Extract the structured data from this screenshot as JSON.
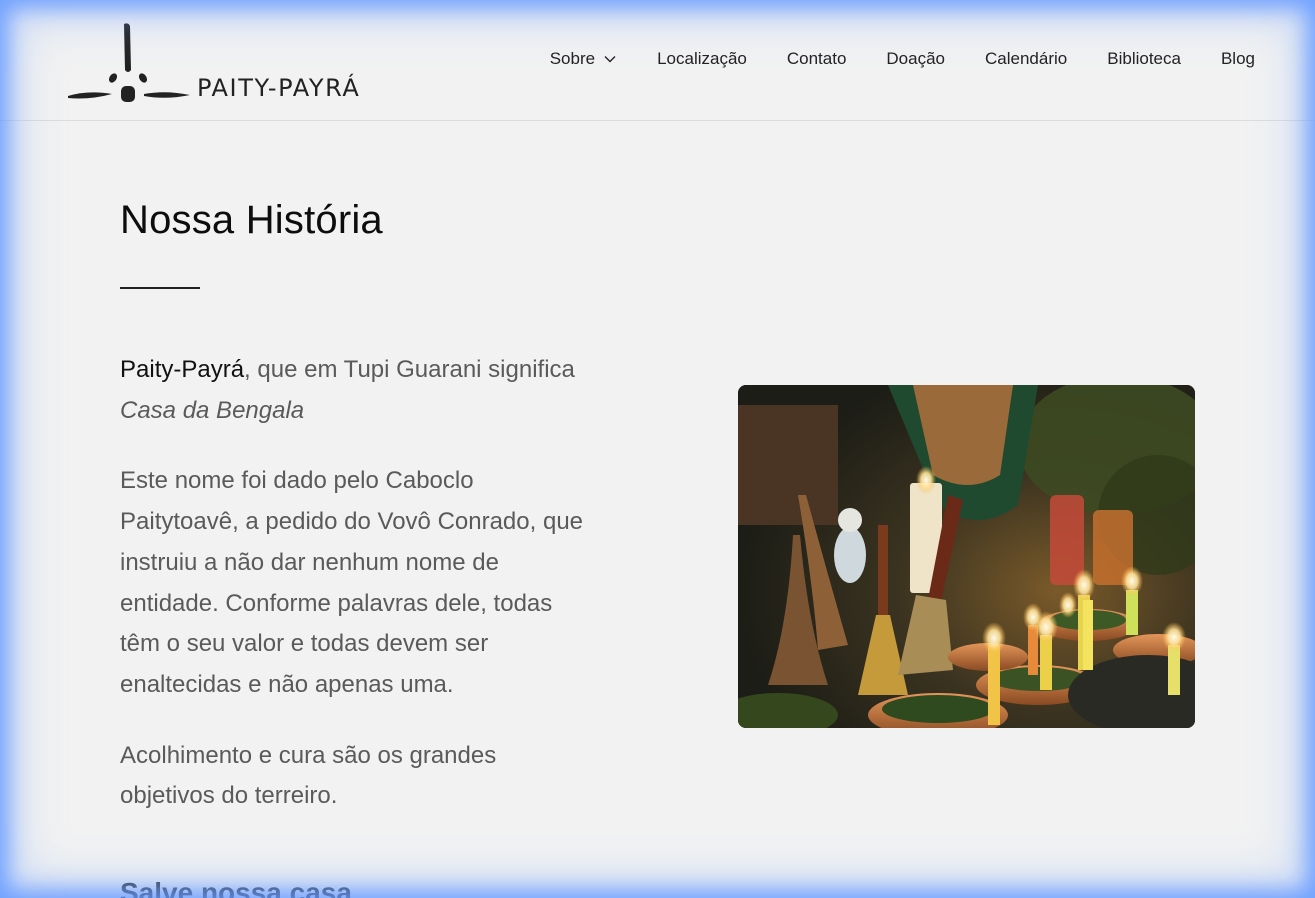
{
  "site": {
    "logo_text": "PAITY-PAYRÁ"
  },
  "nav": {
    "items": [
      {
        "label": "Sobre",
        "has_dropdown": true
      },
      {
        "label": "Localização"
      },
      {
        "label": "Contato"
      },
      {
        "label": "Doação"
      },
      {
        "label": "Calendário"
      },
      {
        "label": "Biblioteca"
      },
      {
        "label": "Blog"
      }
    ]
  },
  "page": {
    "title": "Nossa História",
    "intro_brand": "Paity-Payrá",
    "intro_rest": ", que em Tupi Guarani significa ",
    "intro_em": "Casa da Bengala",
    "paragraph_2": "Este nome foi dado pelo Caboclo Paitytoavê, a pedido do Vovô Conrado, que instruiu a não dar nenhum nome de entidade. Conforme palavras dele, todas têm o seu valor e todas devem ser enaltecidas e não apenas uma.",
    "paragraph_3": "Acolhimento e cura são os grandes objetivos do terreiro.",
    "next_heading": "Salve nossa casa"
  },
  "colors": {
    "background": "#f2f2f2",
    "text_dark": "#111111",
    "text_body": "#5a5a5a",
    "glow": "#5f96ff"
  },
  "icons": {
    "logo_mark": "cane-and-dots-logo",
    "dropdown": "chevron-down-icon"
  },
  "image": {
    "subject": "ritual altar with lit candles, herbs in clay bowls and wicker rattles"
  }
}
